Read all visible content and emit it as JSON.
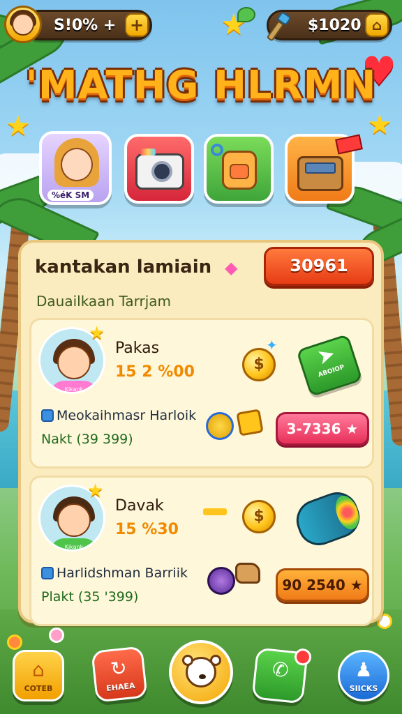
{
  "top_bar": {
    "left_counter": "S!0% +",
    "left_plus": "+",
    "right_counter": "$1020",
    "right_button": "⌂"
  },
  "title": "'MATHG HLRMN",
  "tiles": [
    {
      "name": "profile",
      "caption": "%éK SM"
    },
    {
      "name": "camera",
      "caption": ""
    },
    {
      "name": "backpack",
      "caption": ""
    },
    {
      "name": "shop",
      "caption": ""
    }
  ],
  "panel": {
    "title": "kantakan lamiain",
    "subtitle": "Dauailkaan Tarrjam",
    "header_button": "30961"
  },
  "cards": [
    {
      "player_name": "Pakas",
      "player_score": "15 2 %00",
      "shirt_text": "Kikank",
      "task_name": "Meokaihmasr Harloik",
      "task_meta": "Nakt (39  399)",
      "action_button": "ABOIOP",
      "reward_button": "3-7336 ★"
    },
    {
      "player_name": "Davak",
      "player_score": "15 %30",
      "shirt_text": "Kikank",
      "task_name": "Harlidshman Barriik",
      "task_meta": "Plakt (35  '399)",
      "reward_button": "90 2540 ★"
    }
  ],
  "bottom_nav": [
    {
      "label": "COTEB",
      "icon": "⌂"
    },
    {
      "label": "EHAEA",
      "icon": "↻"
    },
    {
      "label": "",
      "icon": ""
    },
    {
      "label": "",
      "icon": "✆"
    },
    {
      "label": "SIICKS",
      "icon": "♟"
    }
  ],
  "colors": {
    "accent_orange": "#f08a00",
    "title_gold": "#ffb21a",
    "panel_bg": "#fbecbf",
    "red_button": "#e73c14",
    "green_button": "#3fb33a",
    "pink_button": "#f04a70"
  }
}
